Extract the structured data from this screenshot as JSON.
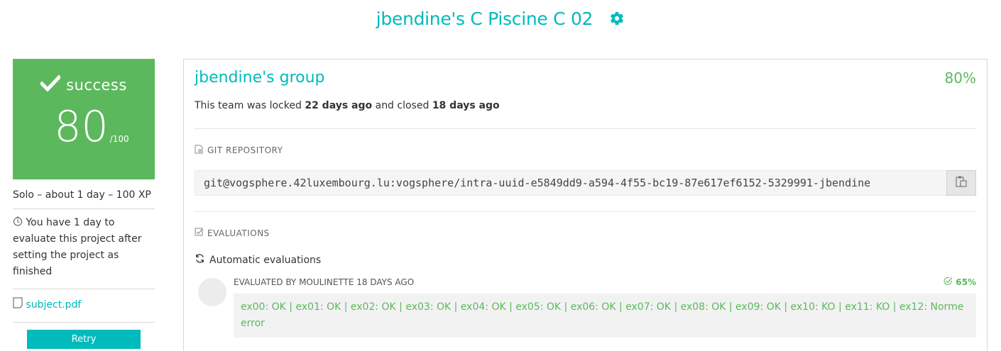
{
  "header": {
    "title": "jbendine's C Piscine C 02",
    "settings_icon": "gear-icon",
    "accent": "#00babc"
  },
  "status": {
    "label": "success",
    "score": "80",
    "max": "/100",
    "color": "#5cb85c",
    "icon": "check-icon"
  },
  "sidebar": {
    "meta": "Solo – about 1 day – 100 XP",
    "evaluate_notice": "You have 1 day to evaluate this project after setting the project as finished",
    "subject_link": "subject.pdf",
    "retry_label": "Retry"
  },
  "team": {
    "name": "jbendine's group",
    "percent": "80%",
    "locked_prefix": "This team was locked",
    "locked_time": "22 days ago",
    "closed_prefix": "and closed",
    "closed_time": "18 days ago"
  },
  "repository": {
    "section_label": "GIT REPOSITORY",
    "url": "git@vogsphere.42luxembourg.lu:vogsphere/intra-uuid-e5849dd9-a594-4f55-bc19-87e617ef6152-5329991-jbendine"
  },
  "evaluations": {
    "section_label": "EVALUATIONS",
    "auto_label": "Automatic evaluations",
    "items": [
      {
        "header": "EVALUATED BY MOULINETTE 18 DAYS AGO",
        "percent": "65%",
        "details": "ex00: OK | ex01: OK | ex02: OK | ex03: OK | ex04: OK | ex05: OK | ex06: OK | ex07: OK | ex08: OK | ex09: OK | ex10: KO | ex11: KO | ex12: Norme error"
      }
    ]
  }
}
